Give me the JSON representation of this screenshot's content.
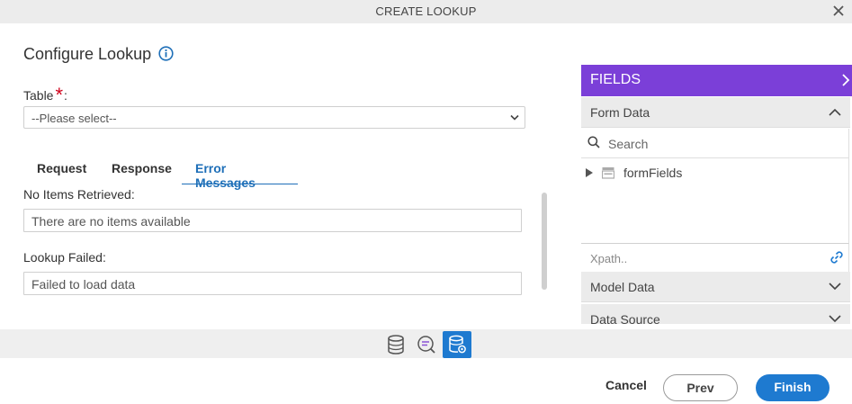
{
  "dialog": {
    "title": "CREATE LOOKUP"
  },
  "main": {
    "heading": "Configure Lookup",
    "table_label": "Table",
    "required_mark": "*",
    "colon": ":",
    "table_select": {
      "value": "--Please select--"
    },
    "tabs": [
      {
        "label": "Request",
        "active": false
      },
      {
        "label": "Response",
        "active": false
      },
      {
        "label": "Error Messages",
        "active": true
      }
    ],
    "fields": [
      {
        "label": "No Items Retrieved:",
        "value": "There are no items available"
      },
      {
        "label": "Lookup Failed:",
        "value": "Failed to load data"
      }
    ]
  },
  "panel": {
    "title": "FIELDS",
    "form_data": "Form Data",
    "search_placeholder": "Search",
    "tree": [
      {
        "label": "formFields",
        "icon": "table-icon"
      }
    ],
    "xpath_placeholder": "Xpath..",
    "model_data": "Model Data",
    "data_source": "Data Source"
  },
  "toolbar": {
    "icons": [
      "database-icon",
      "search-query-icon",
      "database-settings-icon"
    ],
    "active_index": 2
  },
  "footer": {
    "cancel": "Cancel",
    "prev": "Prev",
    "finish": "Finish"
  },
  "colors": {
    "accent": "#1e7ad0",
    "panel_header": "#7b3fd8",
    "required": "#d0021b"
  }
}
